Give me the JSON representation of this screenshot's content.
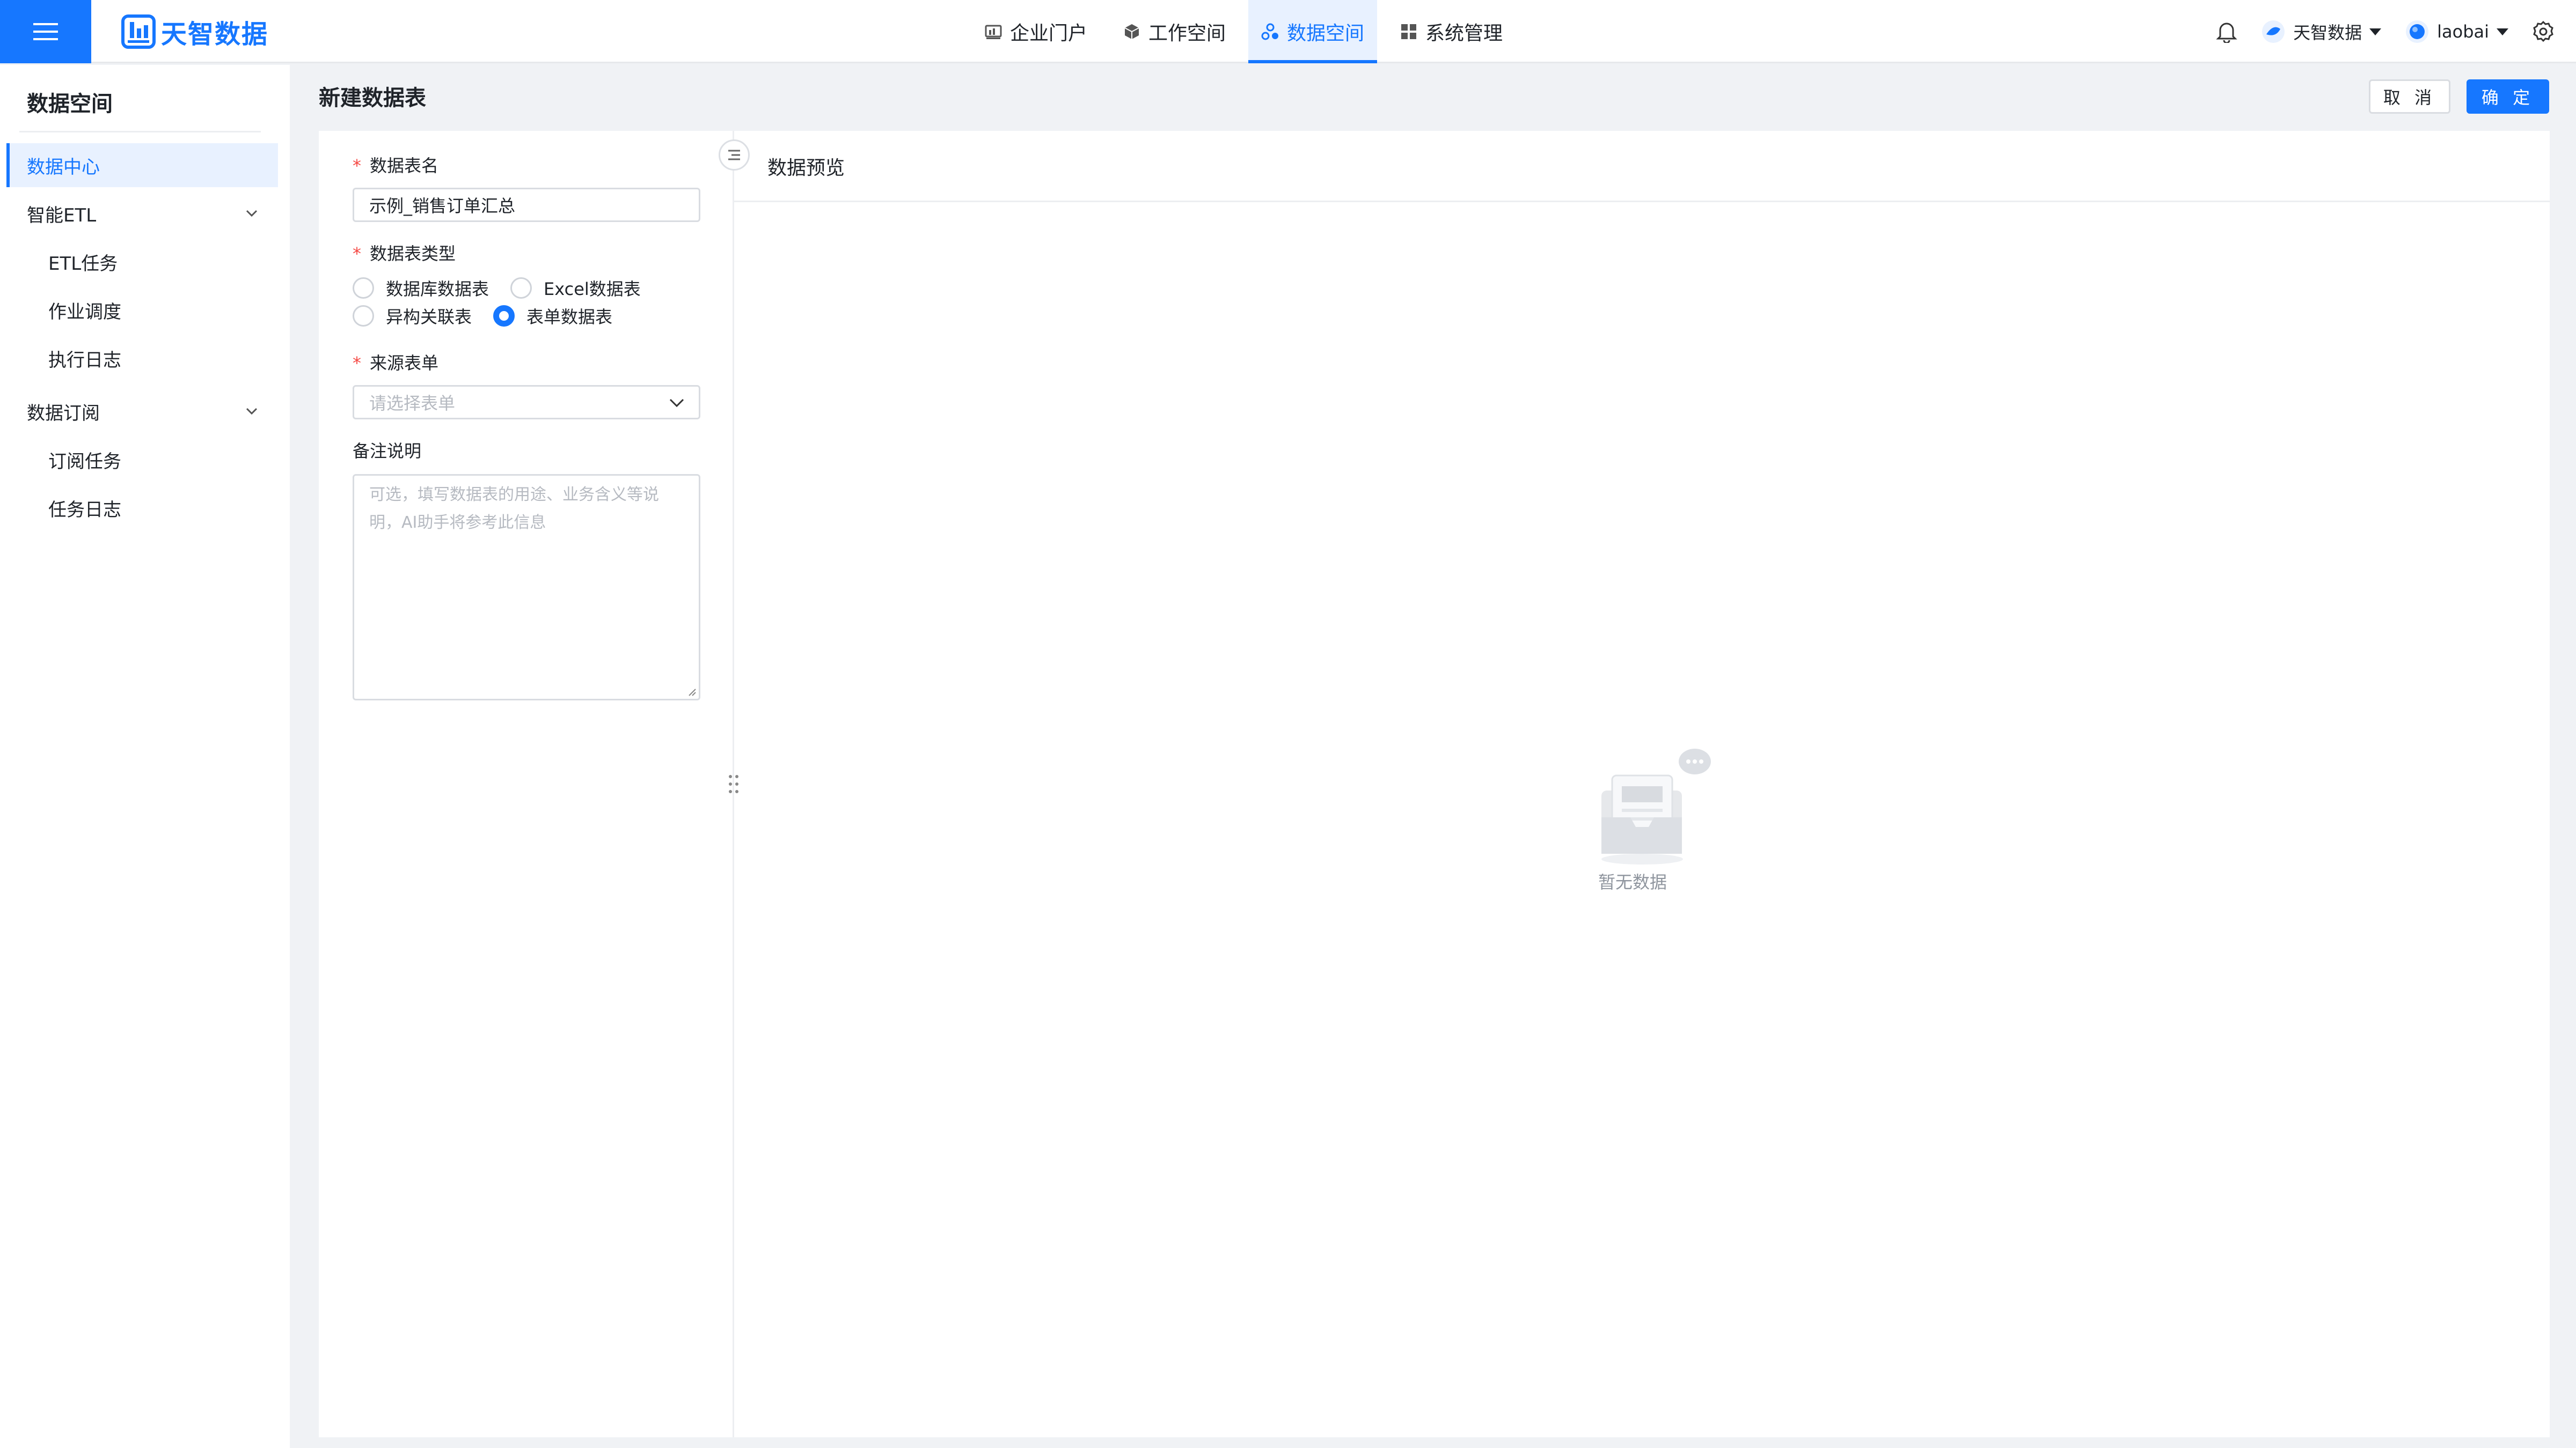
{
  "app": {
    "logo_text": "天智数据"
  },
  "nav": {
    "items": [
      {
        "label": "企业门户",
        "icon": "dashboard-icon"
      },
      {
        "label": "工作空间",
        "icon": "cube-icon"
      },
      {
        "label": "数据空间",
        "icon": "data-space-icon",
        "active": true
      },
      {
        "label": "系统管理",
        "icon": "apps-icon"
      }
    ]
  },
  "header_right": {
    "org_name": "天智数据",
    "user_name": "laobai"
  },
  "sidebar": {
    "title": "数据空间",
    "items": [
      {
        "label": "数据中心",
        "active": true
      },
      {
        "label": "智能ETL",
        "group": true
      },
      {
        "label": "ETL任务"
      },
      {
        "label": "作业调度"
      },
      {
        "label": "执行日志"
      },
      {
        "label": "数据订阅",
        "group": true
      },
      {
        "label": "订阅任务"
      },
      {
        "label": "任务日志"
      }
    ]
  },
  "page": {
    "title": "新建数据表",
    "cancel_label": "取 消",
    "ok_label": "确 定"
  },
  "form": {
    "required_mark": "*",
    "name_label": "数据表名",
    "name_value": "示例_销售订单汇总",
    "type_label": "数据表类型",
    "type_options": [
      {
        "label": "数据库数据表",
        "checked": false
      },
      {
        "label": "Excel数据表",
        "checked": false
      },
      {
        "label": "异构关联表",
        "checked": false
      },
      {
        "label": "表单数据表",
        "checked": true
      }
    ],
    "source_label": "来源表单",
    "source_placeholder": "请选择表单",
    "remark_label": "备注说明",
    "remark_placeholder": "可选，填写数据表的用途、业务含义等说明，AI助手将参考此信息"
  },
  "preview": {
    "title": "数据预览",
    "empty_text": "暂无数据"
  },
  "colors": {
    "primary": "#1677ff",
    "required": "#f54a45"
  }
}
